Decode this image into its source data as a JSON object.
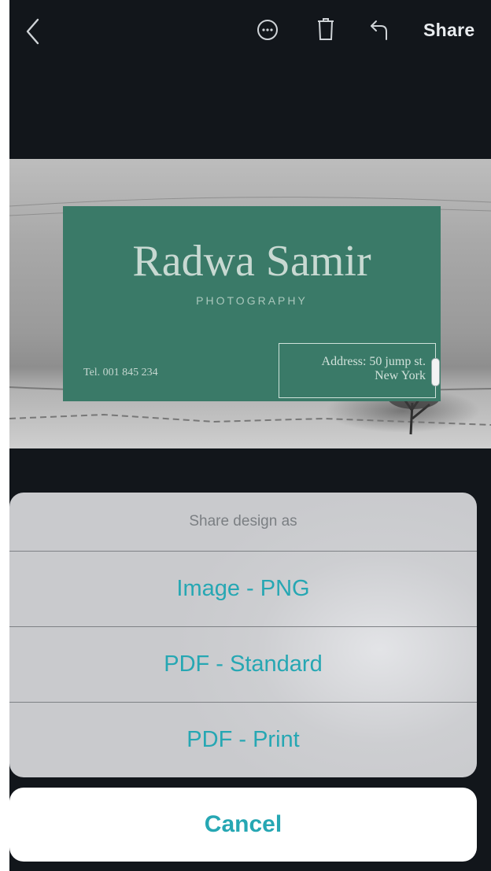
{
  "toolbar": {
    "share_label": "Share",
    "icons": [
      "back-chevron-icon",
      "more-options-icon",
      "trash-icon",
      "undo-icon"
    ]
  },
  "card": {
    "name": "Radwa Samir",
    "subtitle": "PHOTOGRAPHY",
    "tel": "Tel. 001 845 234",
    "address_line1": "Address: 50 jump st.",
    "address_line2": "New York",
    "background_color": "#3a7a68"
  },
  "share_sheet": {
    "title": "Share design as",
    "options": [
      {
        "label": "Image - PNG"
      },
      {
        "label": "PDF - Standard"
      },
      {
        "label": "PDF - Print"
      }
    ],
    "cancel_label": "Cancel",
    "accent_color": "#26a7b3"
  }
}
